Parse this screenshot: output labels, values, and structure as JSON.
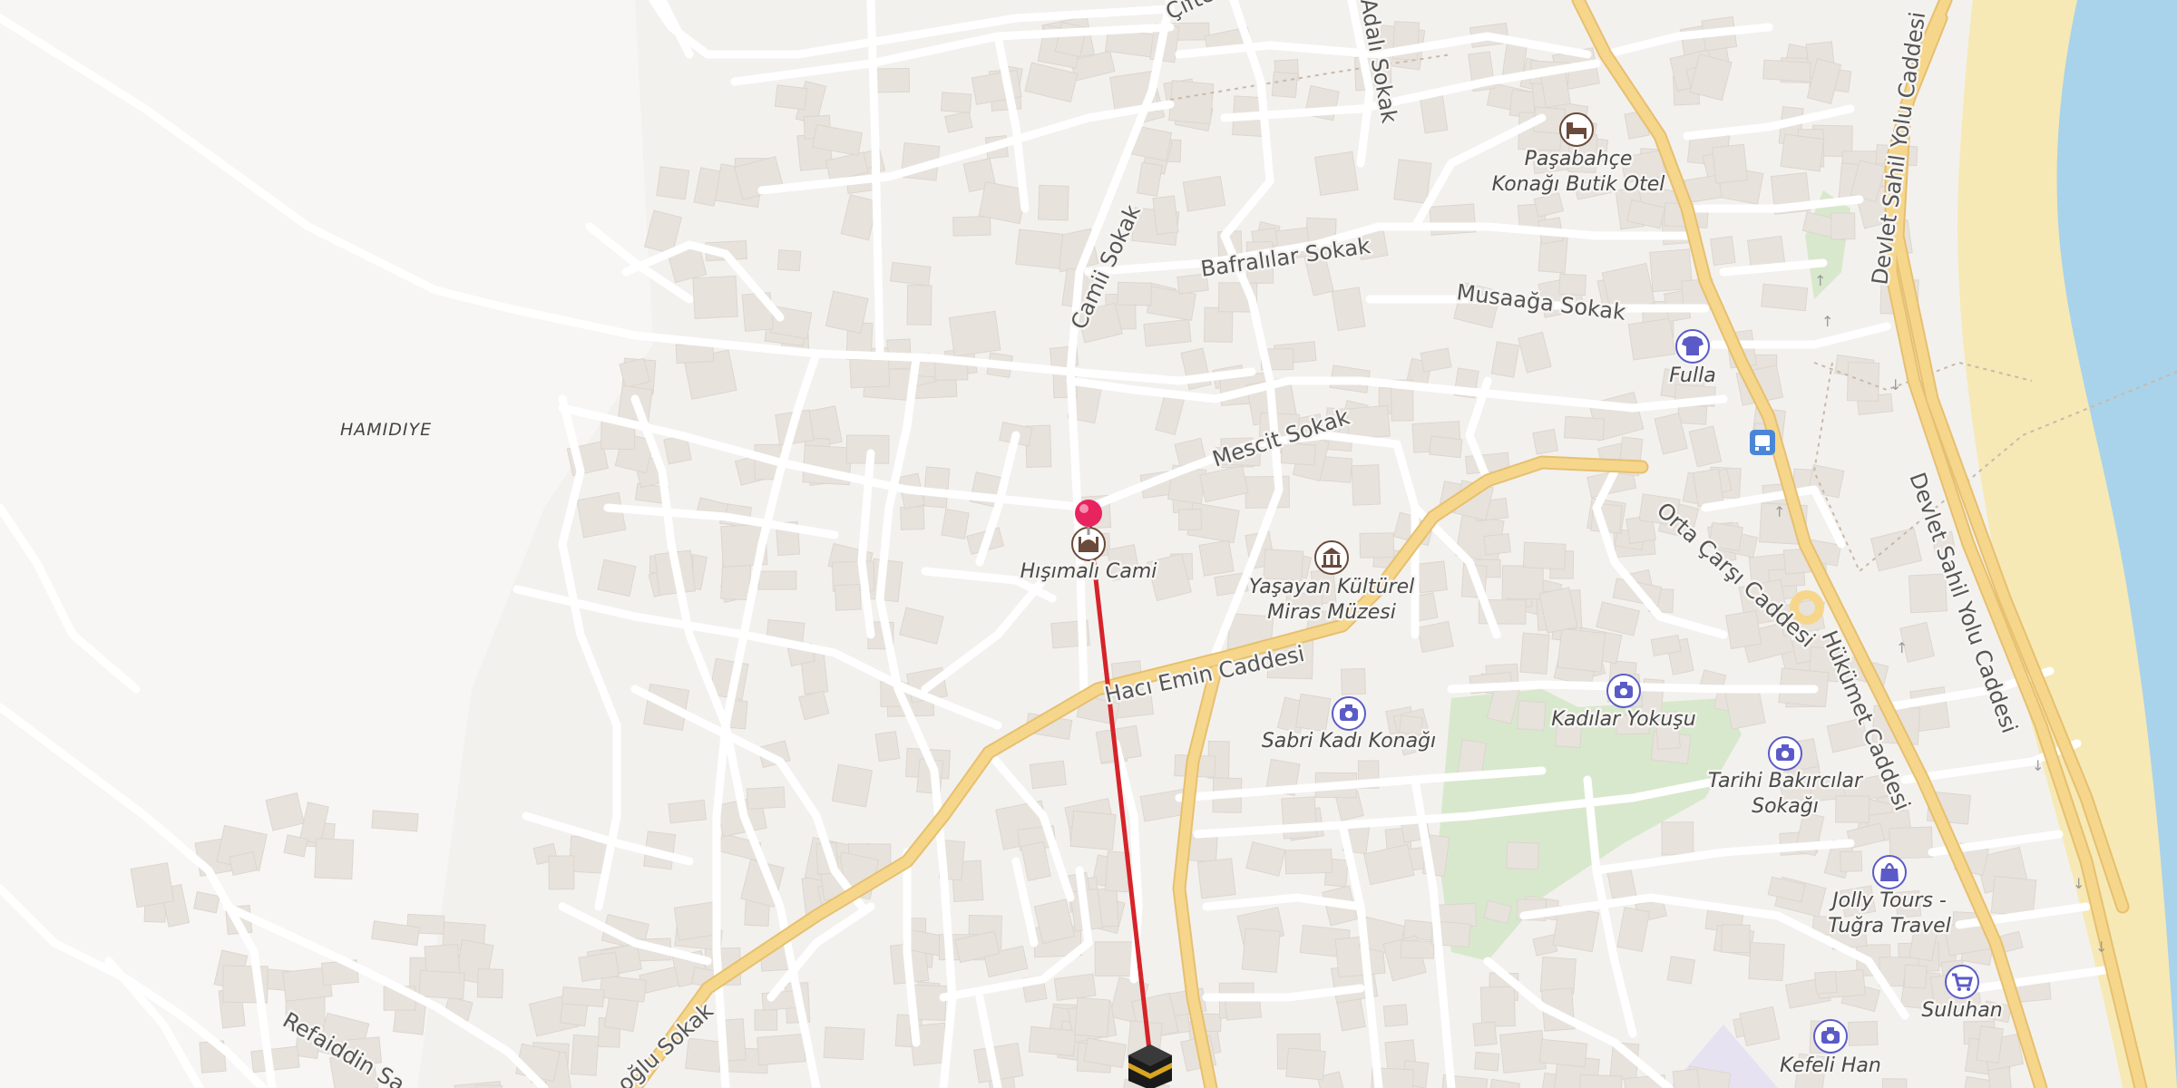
{
  "map": {
    "district": "HAMIDIYE",
    "streets": {
      "ciftci": "Çifte",
      "adali": "Adalı Sokak",
      "camii": "Camii Sokak",
      "bafralilar": "Bafralılar Sokak",
      "musaaga": "Musaağa Sokak",
      "mescit": "Mescit Sokak",
      "haci_emin": "Hacı Emin Caddesi",
      "orta_carsi": "Orta Çarşı Caddesi",
      "hukumet": "Hükümet Caddesi",
      "devlet_1": "Devlet Sahil Yolu Caddesi",
      "devlet_2": "Devlet Sahil Yolu Caddesi",
      "refaiddin": "Refaiddin Sa",
      "oglu": "oğlu Sokak"
    },
    "pois": {
      "pasabahce_1": "Paşabahçe",
      "pasabahce_2": "Konağı Butik Otel",
      "fulla": "Fulla",
      "hisimali": "Hışımalı Cami",
      "yasayan_1": "Yaşayan Kültürel",
      "yasayan_2": "Miras Müzesi",
      "sabri": "Sabri Kadı Konağı",
      "kadilar": "Kadılar Yokuşu",
      "tarihi_1": "Tarihi Bakırcılar",
      "tarihi_2": "Sokağı",
      "jolly_1": "Jolly Tours -",
      "jolly_2": "Tuğra Travel",
      "suluhan": "Suluhan",
      "kefeli": "Kefeli Han"
    },
    "colors": {
      "land": "#f3f1ee",
      "building": "#e7e2dc",
      "road_minor": "#ffffff",
      "road_major": "#f6d68a",
      "water": "#a9d3ea",
      "beach": "#f6e9b6",
      "park": "#d8e8cc",
      "qibla_line": "#d6232a",
      "pin": "#e8245f",
      "poi_icon": "#5b5bc8"
    },
    "icons": {
      "hotel": "bed-icon",
      "mosque": "mosque-icon",
      "museum": "museum-icon",
      "camera": "camera-icon",
      "clothes": "shirt-icon",
      "bag": "shopping-bag-icon",
      "cart": "shopping-cart-icon",
      "bus": "bus-stop-icon",
      "kaaba": "kaaba-icon",
      "pin": "location-pin-icon"
    }
  }
}
